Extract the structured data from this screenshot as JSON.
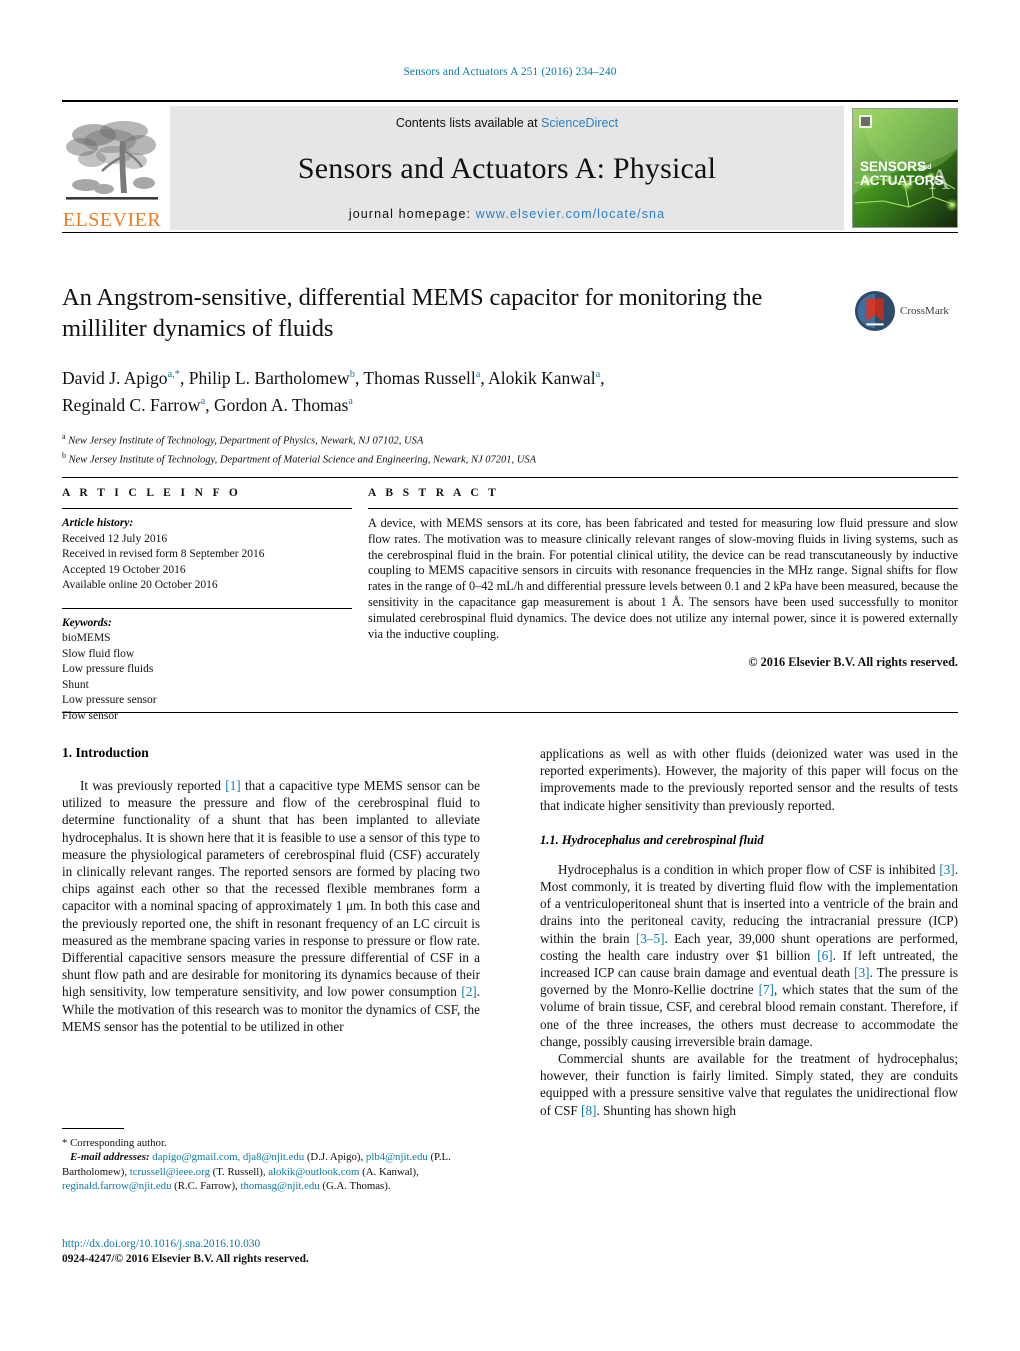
{
  "running_head": "Sensors and Actuators A 251 (2016) 234–240",
  "masthead": {
    "contents_prefix": "Contents lists available at ",
    "contents_link": "ScienceDirect",
    "journal_title": "Sensors and Actuators A: Physical",
    "homepage_prefix": "journal homepage: ",
    "homepage_url": "www.elsevier.com/locate/sna",
    "publisher_wordmark": "ELSEVIER",
    "cover_line1": "SENSORS",
    "cover_and": "and",
    "cover_line2": "ACTUATORS",
    "cover_letter": "A"
  },
  "article": {
    "title": "An Angstrom-sensitive, differential MEMS capacitor for monitoring the milliliter dynamics of fluids",
    "crossmark_label": "CrossMark",
    "authors_line1": "David J. Apigo",
    "authors": [
      {
        "name": "David J. Apigo",
        "sup": "a,*"
      },
      {
        "name": "Philip L. Bartholomew",
        "sup": "b"
      },
      {
        "name": "Thomas Russell",
        "sup": "a"
      },
      {
        "name": "Alokik Kanwal",
        "sup": "a"
      },
      {
        "name": "Reginald C. Farrow",
        "sup": "a"
      },
      {
        "name": "Gordon A. Thomas",
        "sup": "a"
      }
    ],
    "affiliations": [
      {
        "sup": "a",
        "text": "New Jersey Institute of Technology, Department of Physics, Newark, NJ 07102, USA"
      },
      {
        "sup": "b",
        "text": "New Jersey Institute of Technology, Department of Material Science and Engineering, Newark, NJ 07201, USA"
      }
    ]
  },
  "article_info": {
    "heading": "A R T I C L E   I N F O",
    "history_label": "Article history:",
    "history": [
      "Received 12 July 2016",
      "Received in revised form 8 September 2016",
      "Accepted 19 October 2016",
      "Available online 20 October 2016"
    ],
    "keywords_label": "Keywords:",
    "keywords": [
      "bioMEMS",
      "Slow fluid flow",
      "Low pressure fluids",
      "Shunt",
      "Low pressure sensor",
      "Flow sensor"
    ]
  },
  "abstract": {
    "heading": "A B S T R A C T",
    "text": "A device, with MEMS sensors at its core, has been fabricated and tested for measuring low fluid pressure and slow flow rates. The motivation was to measure clinically relevant ranges of slow-moving fluids in living systems, such as the cerebrospinal fluid in the brain. For potential clinical utility, the device can be read transcutaneously by inductive coupling to MEMS capacitive sensors in circuits with resonance frequencies in the MHz range. Signal shifts for flow rates in the range of 0–42 mL/h and differential pressure levels between 0.1 and 2 kPa have been measured, because the sensitivity in the capacitance gap measurement is about 1 Å. The sensors have been used successfully to monitor simulated cerebrospinal fluid dynamics. The device does not utilize any internal power, since it is powered externally via the inductive coupling.",
    "copyright": "© 2016 Elsevier B.V. All rights reserved."
  },
  "body": {
    "section1_heading": "1.  Introduction",
    "left_para1_a": "It was previously reported ",
    "left_para1_ref1": "[1]",
    "left_para1_b": " that a capacitive type MEMS sensor can be utilized to measure the pressure and flow of the cerebrospinal fluid to determine functionality of a shunt that has been implanted to alleviate hydrocephalus. It is shown here that it is feasible to use a sensor of this type to measure the physiological parameters of cerebrospinal fluid (CSF) accurately in clinically relevant ranges. The reported sensors are formed by placing two chips against each other so that the recessed flexible membranes form a capacitor with a nominal spacing of approximately 1 μm. In both this case and the previously reported one, the shift in resonant frequency of an LC circuit is measured as the membrane spacing varies in response to pressure or flow rate. Differential capacitive sensors measure the pressure differential of CSF in a shunt flow path and are desirable for monitoring its dynamics because of their high sensitivity, low temperature sensitivity, and low power consumption ",
    "left_para1_ref2": "[2]",
    "left_para1_c": ". While the motivation of this research was to monitor the dynamics of CSF, the MEMS sensor has the potential to be utilized in other",
    "right_para1": "applications as well as with other fluids (deionized water was used in the reported experiments). However, the majority of this paper will focus on the improvements made to the previously reported sensor and the results of tests that indicate higher sensitivity than previously reported.",
    "section11_heading": "1.1.  Hydrocephalus and cerebrospinal fluid",
    "right_para2_a": "Hydrocephalus is a condition in which proper flow of CSF is inhibited ",
    "right_para2_ref3": "[3]",
    "right_para2_b": ". Most commonly, it is treated by diverting fluid flow with the implementation of a ventriculoperitoneal shunt that is inserted into a ventricle of the brain and drains into the peritoneal cavity, reducing the intracranial pressure (ICP) within the brain ",
    "right_para2_ref35": "[3–5]",
    "right_para2_c": ". Each year, 39,000 shunt operations are performed, costing the health care industry over $1 billion ",
    "right_para2_ref6": "[6]",
    "right_para2_d": ". If left untreated, the increased ICP can cause brain damage and eventual death ",
    "right_para2_ref3b": "[3]",
    "right_para2_e": ". The pressure is governed by the Monro-Kellie doctrine ",
    "right_para2_ref7": "[7]",
    "right_para2_f": ", which states that the sum of the volume of brain tissue, CSF, and cerebral blood remain constant. Therefore, if one of the three increases, the others must decrease to accommodate the change, possibly causing irreversible brain damage.",
    "right_para3_a": "Commercial shunts are available for the treatment of hydrocephalus; however, their function is fairly limited. Simply stated, they are conduits equipped with a pressure sensitive valve that regulates the unidirectional flow of CSF ",
    "right_para3_ref8": "[8]",
    "right_para3_b": ". Shunting has shown high"
  },
  "footnote": {
    "corresponding": "*  Corresponding author.",
    "email_label": "E-mail addresses:",
    "emails_text_1": "dapigo@gmail.com, dja8@njit.edu",
    "emails_paren_1": " (D.J. Apigo), ",
    "emails_text_2": "plb4@njit.edu",
    "emails_paren_2": " (P.L. Bartholomew), ",
    "emails_text_3": "tcrussell@ieee.org",
    "emails_paren_3": " (T. Russell), ",
    "emails_text_4": "alokik@outlook.com",
    "emails_paren_4": " (A. Kanwal), ",
    "emails_text_5": "reginald.farrow@njit.edu",
    "emails_paren_5": " (R.C. Farrow), ",
    "emails_text_6": "thomasg@njit.edu",
    "emails_paren_6": " (G.A. Thomas)."
  },
  "doi": {
    "url": "http://dx.doi.org/10.1016/j.sna.2016.10.030",
    "issn_line": "0924-4247/© 2016 Elsevier B.V. All rights reserved."
  },
  "colors": {
    "link": "#0b7aa8",
    "elsevier_orange": "#f07c20",
    "band_gray": "#e6e6e6"
  }
}
